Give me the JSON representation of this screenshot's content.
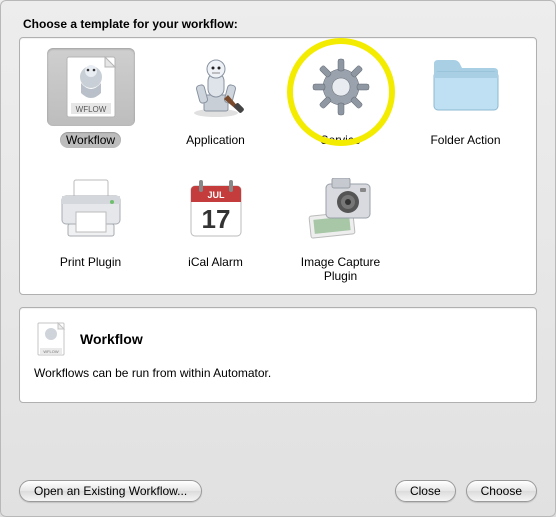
{
  "header": "Choose a template for your workflow:",
  "templates": [
    {
      "label": "Workflow"
    },
    {
      "label": "Application"
    },
    {
      "label": "Service"
    },
    {
      "label": "Folder Action"
    },
    {
      "label": "Print Plugin"
    },
    {
      "label": "iCal Alarm"
    },
    {
      "label": "Image Capture Plugin"
    }
  ],
  "selected_index": 0,
  "highlighted_index": 2,
  "info": {
    "title": "Workflow",
    "description": "Workflows can be run from within Automator."
  },
  "buttons": {
    "open_existing": "Open an Existing Workflow...",
    "close": "Close",
    "choose": "Choose"
  },
  "calendar": {
    "month": "JUL",
    "day": "17"
  },
  "wflow_text": "WFLOW"
}
